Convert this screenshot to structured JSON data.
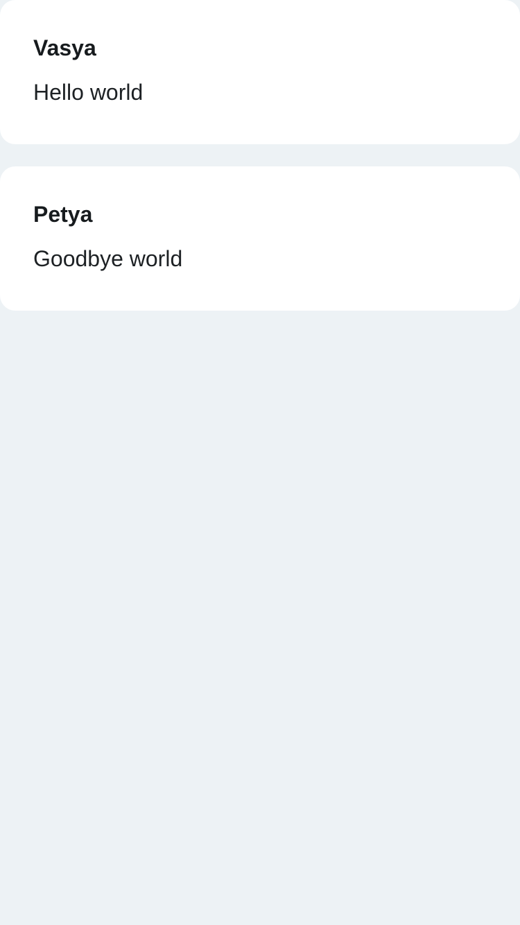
{
  "posts": [
    {
      "author": "Vasya",
      "text": "Hello world"
    },
    {
      "author": "Petya",
      "text": "Goodbye world"
    }
  ],
  "colors": {
    "background": "#edf2f5",
    "card": "#ffffff",
    "text": "#1b1f22"
  }
}
